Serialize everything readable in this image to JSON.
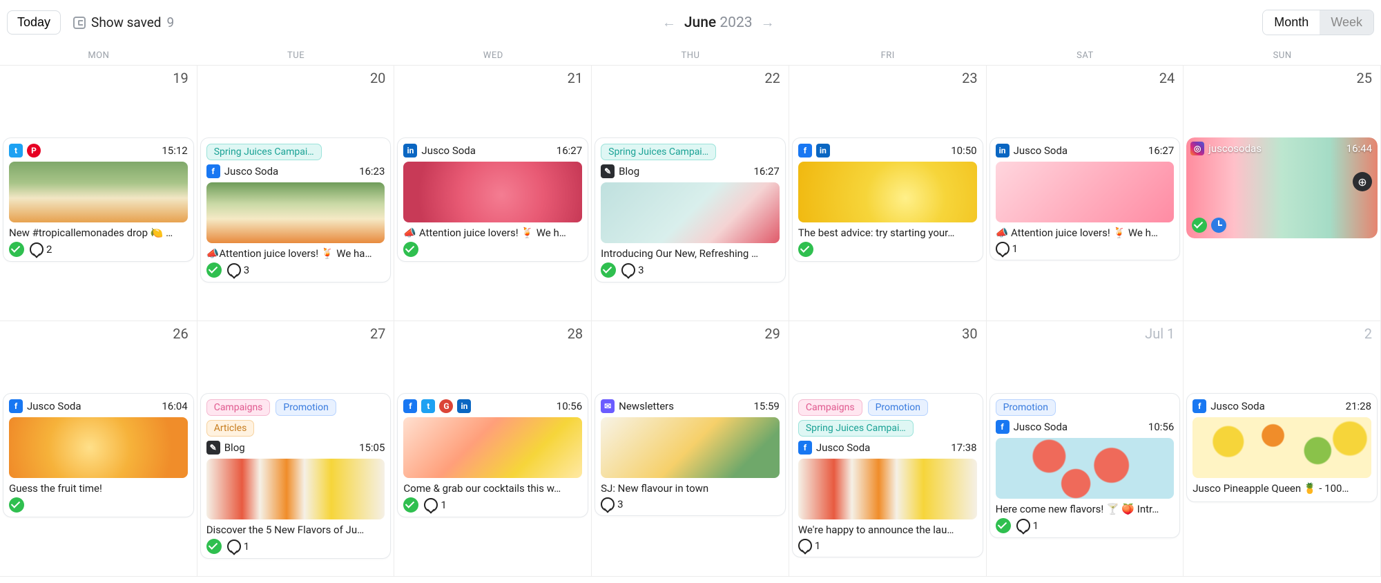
{
  "header": {
    "today": "Today",
    "show_saved_label": "Show saved",
    "show_saved_count": "9",
    "month": "June",
    "year": "2023",
    "view_month": "Month",
    "view_week": "Week"
  },
  "dow": [
    "MON",
    "TUE",
    "WED",
    "THU",
    "FRI",
    "SAT",
    "SUN"
  ],
  "row1": {
    "d19": {
      "date": "19",
      "card": {
        "time": "15:12",
        "caption": "New #tropicallemonades drop 🍋 …",
        "comments": "2"
      }
    },
    "d20": {
      "date": "20",
      "tag": "Spring Juices Campai…",
      "account": "Jusco Soda",
      "time": "16:23",
      "caption": "📣Attention juice lovers! 🍹 We ha…",
      "comments": "3"
    },
    "d21": {
      "date": "21",
      "account": "Jusco Soda",
      "time": "16:27",
      "caption": "📣 Attention juice lovers! 🍹 We h…"
    },
    "d22": {
      "date": "22",
      "tag": "Spring Juices Campai…",
      "account": "Blog",
      "time": "16:27",
      "caption": "Introducing Our New, Refreshing …",
      "comments": "3"
    },
    "d23": {
      "date": "23",
      "time": "10:50",
      "caption": "The best advice: try starting your…"
    },
    "d24": {
      "date": "24",
      "account": "Jusco Soda",
      "time": "16:27",
      "caption": "📣 Attention juice lovers! 🍹 We h…",
      "comments": "1"
    },
    "d25": {
      "date": "25",
      "account": "juscosodas",
      "time": "16:44"
    }
  },
  "row2": {
    "d26": {
      "date": "26",
      "account": "Jusco Soda",
      "time": "16:04",
      "caption": "Guess the fruit time!"
    },
    "d27": {
      "date": "27",
      "tag1": "Campaigns",
      "tag2": "Promotion",
      "tag3": "Articles",
      "account": "Blog",
      "time": "15:05",
      "caption": "Discover the 5 New Flavors of Ju…",
      "comments": "1"
    },
    "d28": {
      "date": "28",
      "time": "10:56",
      "caption": "Come & grab our cocktails this w…",
      "comments": "1"
    },
    "d29": {
      "date": "29",
      "account": "Newsletters",
      "time": "15:59",
      "caption": "SJ: New flavour in town",
      "comments": "3"
    },
    "d30": {
      "date": "30",
      "tag1": "Campaigns",
      "tag2": "Promotion",
      "tag3": "Spring Juices Campai…",
      "account": "Jusco Soda",
      "time": "17:38",
      "caption": "We're happy to announce the lau…",
      "comments": "1"
    },
    "d31": {
      "date": "Jul 1",
      "tag": "Promotion",
      "account": "Jusco Soda",
      "time": "10:56",
      "caption": "Here come new flavors! 🍸 🍑 Intr…",
      "comments": "1"
    },
    "d32": {
      "date": "2",
      "account": "Jusco Soda",
      "time": "21:28",
      "caption": "Jusco Pineapple Queen 🍍 - 100…"
    }
  }
}
